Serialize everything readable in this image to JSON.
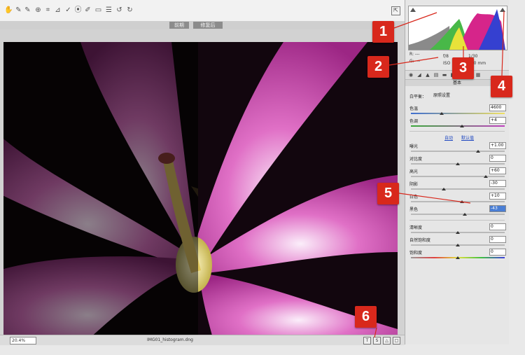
{
  "toolbar": {
    "tool_icons": [
      "hand-icon",
      "eyedropper-icon",
      "color-sampler-icon",
      "target-adjust-icon",
      "crop-icon",
      "straighten-icon",
      "spot-removal-icon",
      "red-eye-icon",
      "adjustment-brush-icon",
      "graduated-filter-icon",
      "preferences-icon",
      "rotate-left-icon",
      "rotate-right-icon"
    ],
    "tool_glyphs": [
      "✋",
      "✎",
      "✎",
      "⊕",
      "⌗",
      "⊿",
      "✓",
      "⦿",
      "✐",
      "▭",
      "☰",
      "↺",
      "↻"
    ],
    "toggle_glyph": "⇱"
  },
  "view_tabs": {
    "before_label": "前期",
    "after_label": "修复后"
  },
  "statusbar": {
    "zoom": "20.4%",
    "filename": "IMG01_histogram.dng",
    "buttons": [
      "T",
      "S",
      "△",
      "□"
    ]
  },
  "histogram": {
    "readout_r": "R: ---",
    "readout_g": "G: ---",
    "readout_iso": "ISO",
    "readout_aperture": "f/8",
    "readout_speed": "1/30",
    "readout_misc": "200 mm"
  },
  "panel": {
    "tab_glyphs": [
      "◉",
      "◢",
      "▲",
      "▤",
      "▬",
      "◧",
      "◨",
      "◫",
      "▦"
    ],
    "section_title": "基本",
    "white_balance_label": "白平衡：",
    "white_balance_value": "原照设置",
    "auto_link": "自动",
    "default_link": "默认值",
    "sliders": [
      {
        "label": "色温",
        "value": "4600"
      },
      {
        "label": "色调",
        "value": "+4"
      },
      {
        "label": "曝光",
        "value": "+1.00"
      },
      {
        "label": "对比度",
        "value": "0"
      },
      {
        "label": "高光",
        "value": "+60"
      },
      {
        "label": "阴影",
        "value": "-30"
      },
      {
        "label": "白色",
        "value": "+10"
      },
      {
        "label": "黑色",
        "value": "-43"
      },
      {
        "label": "清晰度",
        "value": "0"
      },
      {
        "label": "自然饱和度",
        "value": "0"
      },
      {
        "label": "饱和度",
        "value": "0"
      }
    ]
  },
  "callouts": [
    "1",
    "2",
    "3",
    "4",
    "5",
    "6"
  ],
  "colors": {
    "callout_red": "#d8281c",
    "petal_magenta": "#c23a9c",
    "panel_bg": "#e6e6e6"
  }
}
